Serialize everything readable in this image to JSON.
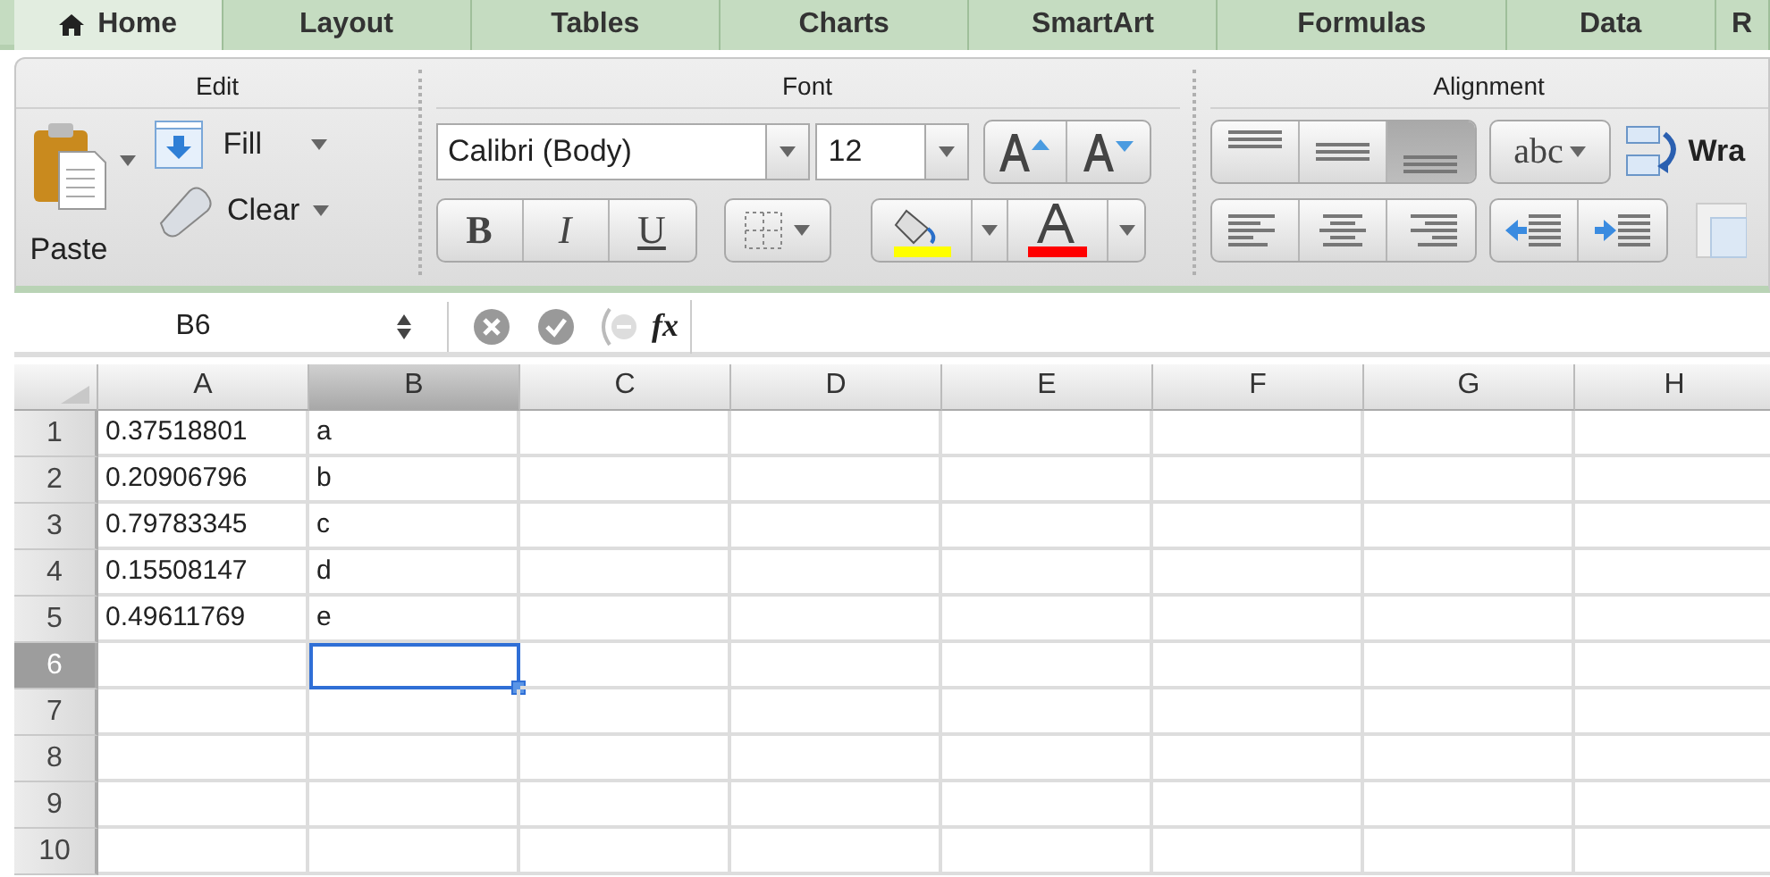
{
  "tabs": [
    {
      "label": "Home",
      "selected": true
    },
    {
      "label": "Layout",
      "selected": false
    },
    {
      "label": "Tables",
      "selected": false
    },
    {
      "label": "Charts",
      "selected": false
    },
    {
      "label": "SmartArt",
      "selected": false
    },
    {
      "label": "Formulas",
      "selected": false
    },
    {
      "label": "Data",
      "selected": false
    },
    {
      "label": "R",
      "selected": false
    }
  ],
  "ribbon": {
    "edit": {
      "title": "Edit",
      "paste": "Paste",
      "fill": "Fill",
      "clear": "Clear"
    },
    "font": {
      "title": "Font",
      "font_name": "Calibri (Body)",
      "font_size": "12",
      "bold": "B",
      "italic": "I",
      "underline": "U"
    },
    "alignment": {
      "title": "Alignment",
      "vertical": [
        {
          "kind": "top",
          "selected": false
        },
        {
          "kind": "middle",
          "selected": false
        },
        {
          "kind": "bottom",
          "selected": true
        }
      ],
      "orientation": "abc",
      "wrap": "Wra"
    }
  },
  "formula_bar": {
    "name_box": "B6",
    "function": "fx"
  },
  "grid": {
    "columns": [
      {
        "label": "A",
        "selected": false
      },
      {
        "label": "B",
        "selected": true
      },
      {
        "label": "C",
        "selected": false
      },
      {
        "label": "D",
        "selected": false
      },
      {
        "label": "E",
        "selected": false
      },
      {
        "label": "F",
        "selected": false
      },
      {
        "label": "G",
        "selected": false
      },
      {
        "label": "H",
        "selected": false
      }
    ],
    "rows": [
      {
        "number": "1",
        "selected": false,
        "cells": [
          "0.37518801",
          "a"
        ]
      },
      {
        "number": "2",
        "selected": false,
        "cells": [
          "0.20906796",
          "b"
        ]
      },
      {
        "number": "3",
        "selected": false,
        "cells": [
          "0.79783345",
          "c"
        ]
      },
      {
        "number": "4",
        "selected": false,
        "cells": [
          "0.15508147",
          "d"
        ]
      },
      {
        "number": "5",
        "selected": false,
        "cells": [
          "0.49611769",
          "e"
        ]
      },
      {
        "number": "6",
        "selected": true,
        "cells": []
      },
      {
        "number": "7",
        "selected": false,
        "cells": []
      },
      {
        "number": "8",
        "selected": false,
        "cells": []
      },
      {
        "number": "9",
        "selected": false,
        "cells": []
      },
      {
        "number": "10",
        "selected": false,
        "cells": []
      }
    ]
  }
}
